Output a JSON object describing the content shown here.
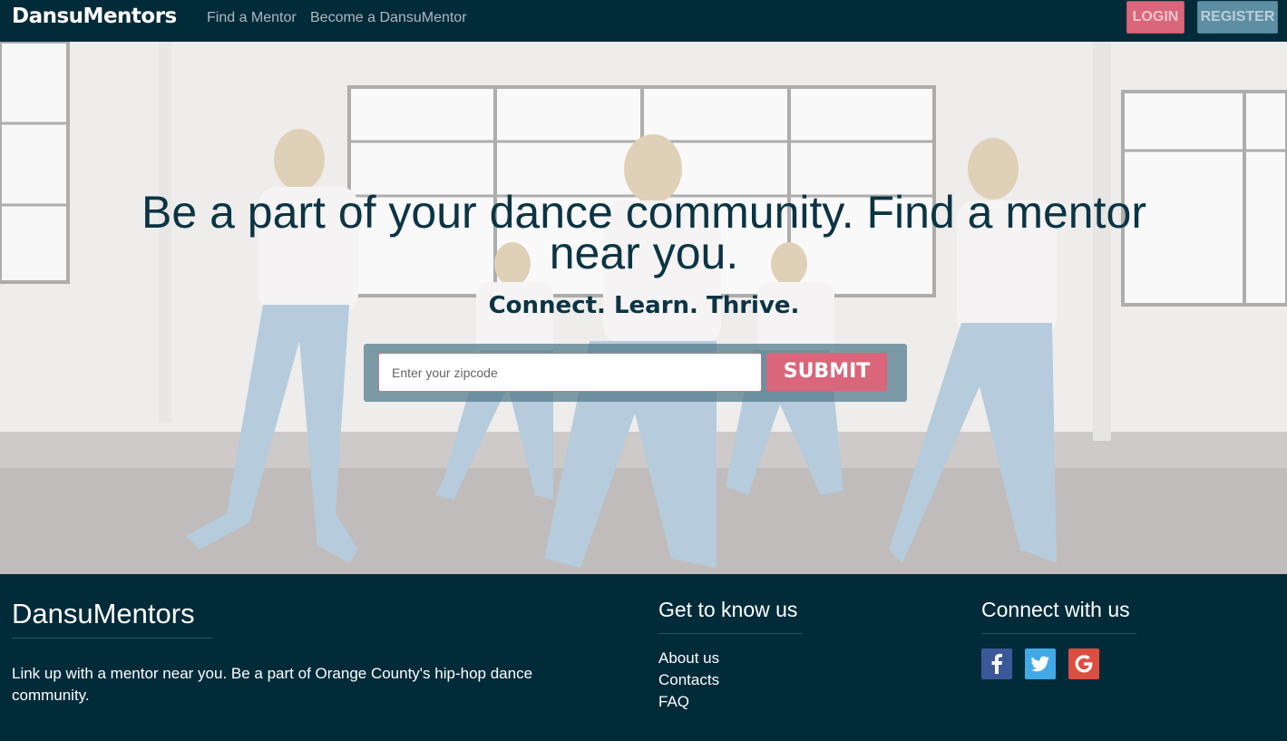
{
  "navbar": {
    "brand": "DansuMentors",
    "links": [
      "Find a Mentor",
      "Become a DansuMentor"
    ],
    "login_label": "LOGIN",
    "register_label": "REGISTER"
  },
  "hero": {
    "title": "Be a part of your dance community. Find a mentor near you.",
    "subtitle": "Connect. Learn. Thrive.",
    "zip_placeholder": "Enter your zipcode",
    "zip_value": "",
    "submit_label": "SUBMIT",
    "background_icon": "dancers-photo"
  },
  "footer": {
    "brand": "DansuMentors",
    "description": "Link up with a mentor near you. Be a part of Orange County's hip-hop dance community.",
    "get_to_know_title": "Get to know us",
    "links": [
      "About us",
      "Contacts",
      "FAQ"
    ],
    "connect_title": "Connect with us",
    "social": [
      {
        "icon": "facebook-icon",
        "color": "#3b5998"
      },
      {
        "icon": "twitter-icon",
        "color": "#42a9e6"
      },
      {
        "icon": "google-icon",
        "color": "#dc4e41"
      }
    ]
  },
  "colors": {
    "navy": "#022b3a",
    "accent_pink": "#d9667a",
    "accent_blue": "#5e8ea3",
    "heading_text": "#0b3444"
  }
}
